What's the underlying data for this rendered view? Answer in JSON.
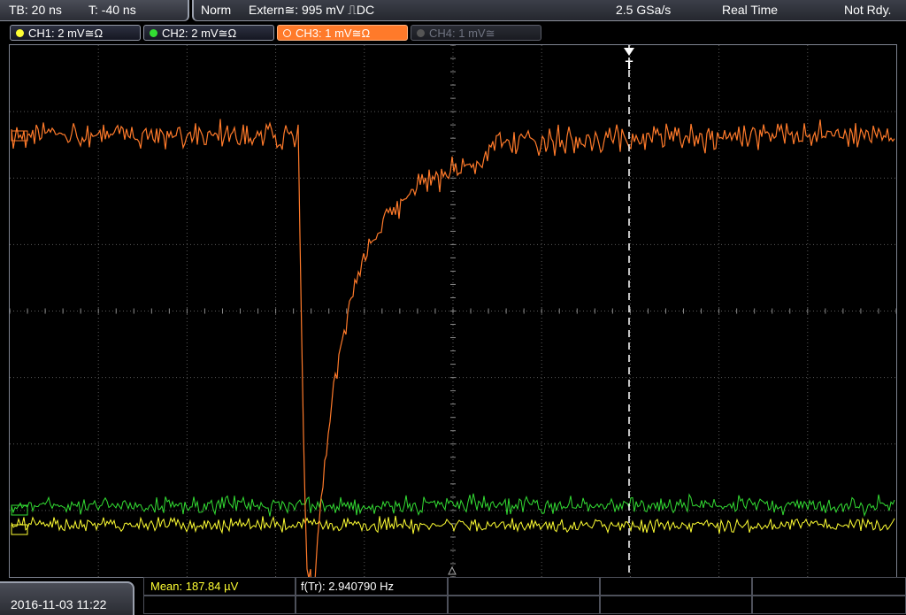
{
  "topbar": {
    "timebase": "TB: 20 ns",
    "trigger_time": "T: -40 ns",
    "mode": "Norm",
    "trigger_source": "Extern≅: 995 mV ⎍DC",
    "sample_rate": "2.5 GSa/s",
    "acquisition": "Real Time",
    "status": "Not Rdy."
  },
  "channels": [
    {
      "label": "CH1: 2 mV≅Ω",
      "color": "#ffff33",
      "active": false,
      "enabled": true
    },
    {
      "label": "CH2: 2 mV≅Ω",
      "color": "#33dd33",
      "active": false,
      "enabled": true
    },
    {
      "label": "CH3: 1 mV≅Ω",
      "color": "#ff7a2a",
      "active": true,
      "enabled": true
    },
    {
      "label": "CH4: 1 mV≅",
      "color": "#555555",
      "active": false,
      "enabled": false
    }
  ],
  "trigger_marker": "T",
  "measurements": {
    "mean": "Mean: 187.84 µV",
    "frequency": "f(Tr): 2.940790 Hz"
  },
  "datetime": "2016-11-03 11:22",
  "colors": {
    "ch1": "#ffff33",
    "ch2": "#33dd33",
    "ch3": "#ff7a2a",
    "grid": "#5a5a5a",
    "trigger_line": "#ffffff"
  }
}
